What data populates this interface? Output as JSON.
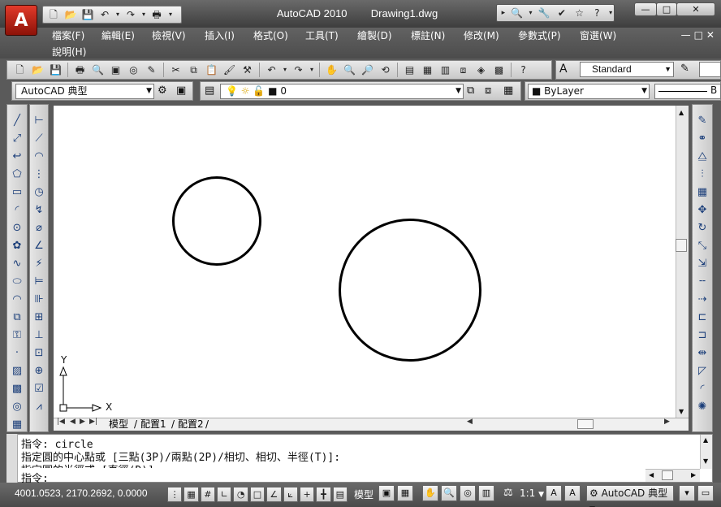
{
  "window": {
    "title": "AutoCAD 2010",
    "document": "Drawing1.dwg",
    "logo_letter": "A",
    "min_symbol": "—",
    "max_symbol": "□",
    "close_symbol": "✕"
  },
  "menu": {
    "items": [
      "檔案(F)",
      "編輯(E)",
      "檢視(V)",
      "插入(I)",
      "格式(O)",
      "工具(T)",
      "繪製(D)",
      "標註(N)",
      "修改(M)",
      "參數式(P)",
      "窗選(W)"
    ],
    "second_row": "說明(H)",
    "doc_controls": "—□✕"
  },
  "toolbars": {
    "text_style": "Standard",
    "workspace": "AutoCAD 典型",
    "layer": "0",
    "color": "ByLayer",
    "linetype_partial": "B"
  },
  "layout_tabs": [
    "模型",
    "配置1",
    "配置2"
  ],
  "drawing": {
    "ucs_x_label": "X",
    "ucs_y_label": "Y"
  },
  "command": {
    "line1": "指令: circle",
    "line2": "指定圓的中心點或 [三點(3P)/兩點(2P)/相切、相切、半徑(T)]:",
    "line3": "指定圓的半徑或 [直徑(D)]:",
    "prompt": "指令:"
  },
  "status": {
    "coordinates": "4001.0523, 2170.2692, 0.0000",
    "model": "模型",
    "annotation_scale": "1:1",
    "workspace": "AutoCAD 典型"
  }
}
